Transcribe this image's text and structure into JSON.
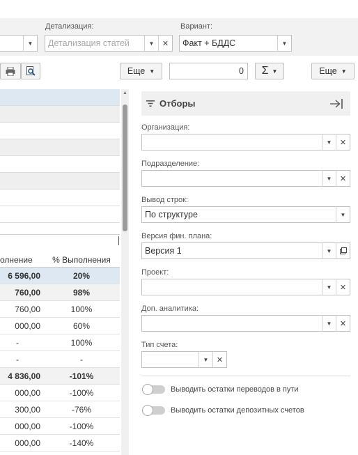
{
  "params": {
    "detail_label": "Детализация:",
    "detail_placeholder": "Детализация статей",
    "variant_label": "Вариант:",
    "variant_value": "Факт + БДДС"
  },
  "toolbar": {
    "more_label": "Еще",
    "number_value": "0",
    "sigma_label": "Σ",
    "more2_label": "Еще"
  },
  "table": {
    "headers": [
      "олнение",
      "% Выполнения"
    ],
    "rows": [
      {
        "a": "6 596,00",
        "b": "20%"
      },
      {
        "a": "760,00",
        "b": "98%"
      },
      {
        "a": "760,00",
        "b": "100%"
      },
      {
        "a": "000,00",
        "b": "60%"
      },
      {
        "a": "-",
        "b": "100%"
      },
      {
        "a": "-",
        "b": "-"
      },
      {
        "a": "4 836,00",
        "b": "-101%"
      },
      {
        "a": "000,00",
        "b": "-100%"
      },
      {
        "a": "300,00",
        "b": "-76%"
      },
      {
        "a": "000,00",
        "b": "-100%"
      },
      {
        "a": "000,00",
        "b": "-140%"
      }
    ]
  },
  "filters": {
    "title": "Отборы",
    "org_label": "Организация:",
    "dept_label": "Подразделение:",
    "rows_label": "Вывод строк:",
    "rows_value": "По структуре",
    "plan_label": "Версия фин. плана:",
    "plan_value": "Версия 1",
    "project_label": "Проект:",
    "analytics_label": "Доп. аналитика:",
    "acct_label": "Тип счета:",
    "toggle1_label": "Выводить остатки переводов в пути",
    "toggle2_label": "Выводить остатки депозитных счетов"
  }
}
